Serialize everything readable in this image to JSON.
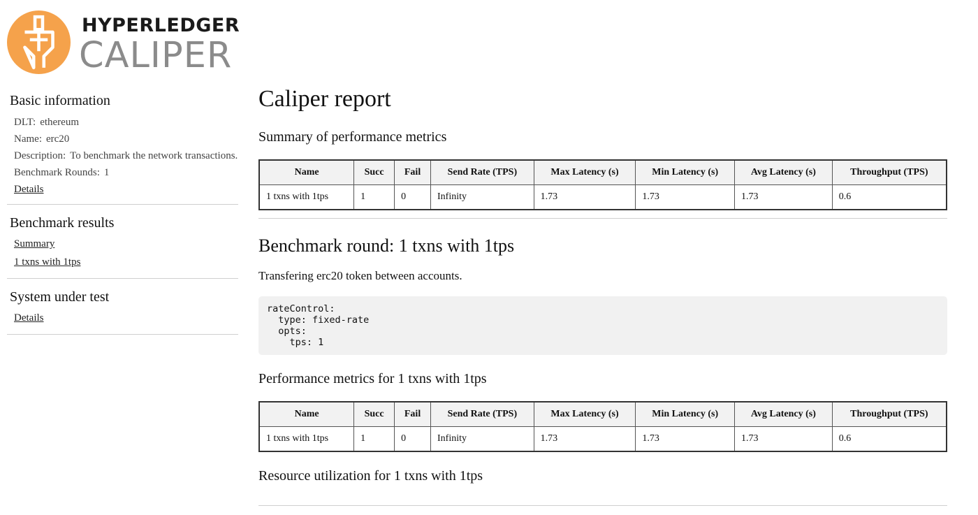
{
  "logo": {
    "top": "HYPERLEDGER",
    "bottom": "CALIPER",
    "colors": {
      "orange": "#F5A24B",
      "white": "#ffffff",
      "gray": "#8b8b8b"
    }
  },
  "sidebar": {
    "basic": {
      "title": "Basic information",
      "dlt_label": "DLT:",
      "dlt_value": "ethereum",
      "name_label": "Name:",
      "name_value": "erc20",
      "desc_label": "Description:",
      "desc_value": "To benchmark the network transactions.",
      "rounds_label": "Benchmark Rounds:",
      "rounds_value": "1",
      "details_link": "Details"
    },
    "results": {
      "title": "Benchmark results",
      "links": [
        "Summary",
        "1 txns with 1tps"
      ]
    },
    "sut": {
      "title": "System under test",
      "details_link": "Details"
    }
  },
  "main": {
    "title": "Caliper report",
    "summary_title": "Summary of performance metrics",
    "headers": [
      "Name",
      "Succ",
      "Fail",
      "Send Rate (TPS)",
      "Max Latency (s)",
      "Min Latency (s)",
      "Avg Latency (s)",
      "Throughput (TPS)"
    ],
    "summary_rows": [
      [
        "1 txns with 1tps",
        "1",
        "0",
        "Infinity",
        "1.73",
        "1.73",
        "1.73",
        "0.6"
      ]
    ],
    "round_title": "Benchmark round: 1 txns with 1tps",
    "round_desc": "Transfering erc20 token between accounts.",
    "config_text": "rateControl:\n  type: fixed-rate\n  opts:\n    tps: 1",
    "perf_title": "Performance metrics for 1 txns with 1tps",
    "perf_rows": [
      [
        "1 txns with 1tps",
        "1",
        "0",
        "Infinity",
        "1.73",
        "1.73",
        "1.73",
        "0.6"
      ]
    ],
    "resource_title": "Resource utilization for 1 txns with 1tps"
  }
}
